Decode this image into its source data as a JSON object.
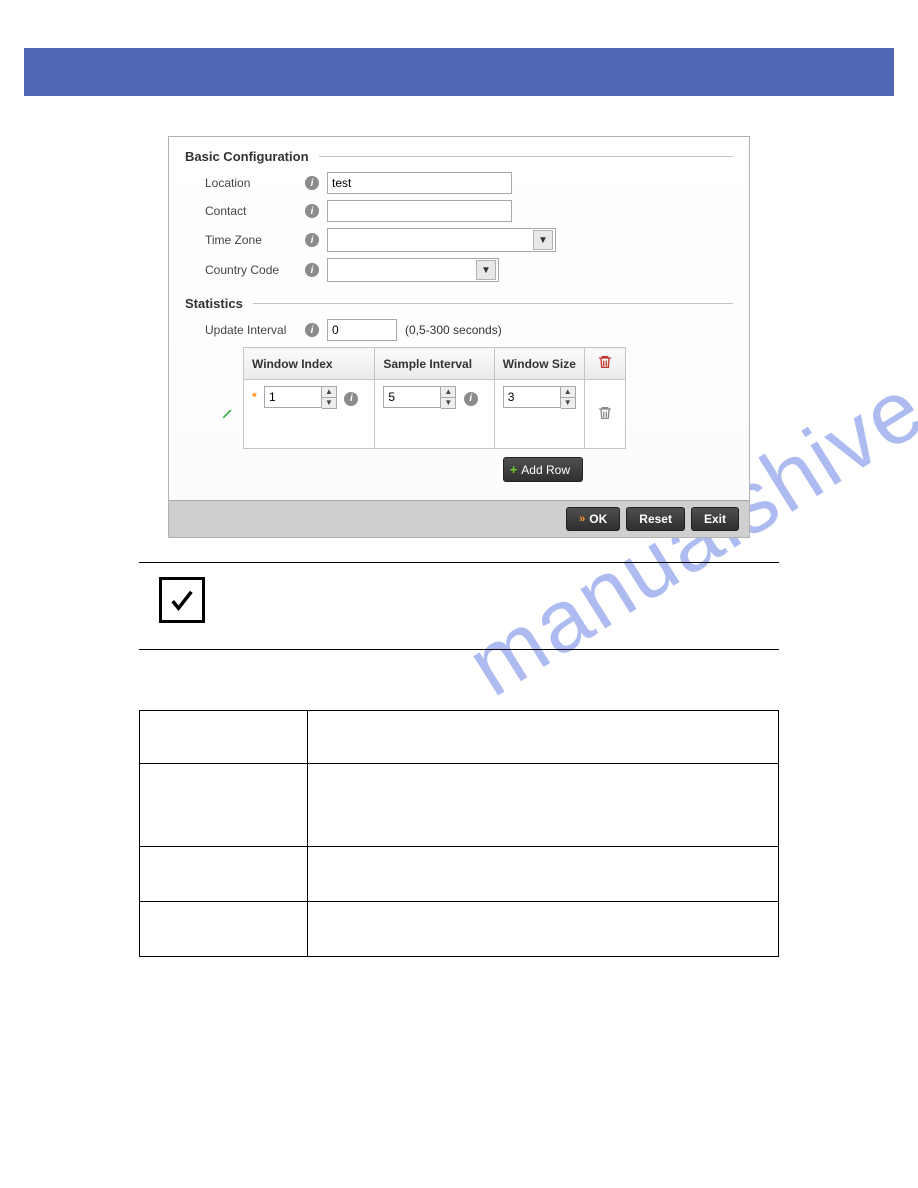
{
  "sections": {
    "basic": {
      "title": "Basic Configuration",
      "location_label": "Location",
      "location_value": "test",
      "contact_label": "Contact",
      "contact_value": "",
      "timezone_label": "Time Zone",
      "timezone_value": "",
      "country_label": "Country Code",
      "country_value": ""
    },
    "statistics": {
      "title": "Statistics",
      "update_interval_label": "Update Interval",
      "update_interval_value": "0",
      "update_interval_hint": "(0,5-300 seconds)",
      "columns": {
        "window_index": "Window Index",
        "sample_interval": "Sample Interval",
        "window_size": "Window Size"
      },
      "row": {
        "window_index": "1",
        "sample_interval": "5",
        "window_size": "3"
      }
    }
  },
  "buttons": {
    "add_row": "Add Row",
    "ok": "OK",
    "reset": "Reset",
    "exit": "Exit"
  },
  "icons": {
    "info": "i",
    "trash": "trash-icon",
    "pencil": "pencil-icon",
    "plus": "+",
    "chevron": "»",
    "check": "check-icon"
  },
  "watermark": "manualshive.com"
}
